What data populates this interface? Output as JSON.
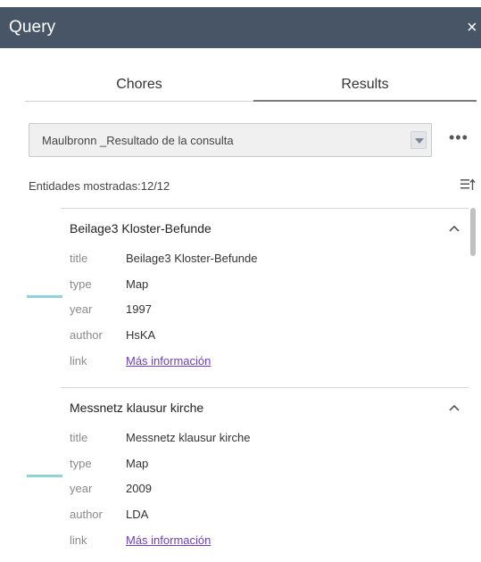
{
  "header": {
    "title": "Query",
    "close_label": "×"
  },
  "tabs": [
    {
      "label": "Chores",
      "active": false
    },
    {
      "label": "Results",
      "active": true
    }
  ],
  "layer_select": {
    "value": "Maulbronn _Resultado de la consulta"
  },
  "more_label": "•••",
  "count_text": "Entidades mostradas:12/12",
  "colors": {
    "header_bg": "#485566",
    "swatch": "#8fd4d8",
    "link": "#6b3fb8"
  },
  "results": [
    {
      "title": "Beilage3 Kloster-Befunde",
      "attributes": [
        {
          "key": "title",
          "value": "Beilage3 Kloster-Befunde"
        },
        {
          "key": "type",
          "value": "Map"
        },
        {
          "key": "year",
          "value": "1997"
        },
        {
          "key": "author",
          "value": "HsKA"
        },
        {
          "key": "link",
          "value": "Más información",
          "is_link": true
        }
      ]
    },
    {
      "title": "Messnetz klausur kirche",
      "attributes": [
        {
          "key": "title",
          "value": "Messnetz klausur kirche"
        },
        {
          "key": "type",
          "value": "Map"
        },
        {
          "key": "year",
          "value": "2009"
        },
        {
          "key": "author",
          "value": "LDA"
        },
        {
          "key": "link",
          "value": "Más información",
          "is_link": true
        }
      ]
    }
  ]
}
